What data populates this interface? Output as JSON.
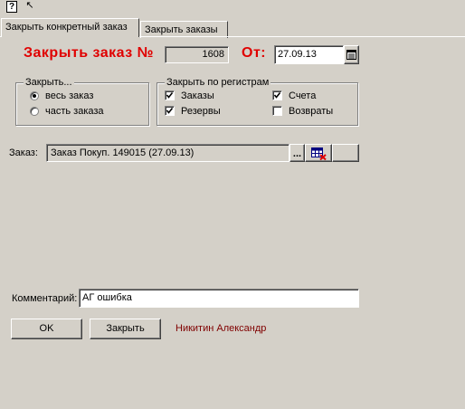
{
  "toolbar": {
    "help_icon": "?",
    "cursor_icon": "↖"
  },
  "tabs": [
    {
      "label": "Закрыть конкретный заказ"
    },
    {
      "label": "Закрыть  заказы"
    }
  ],
  "header": {
    "title": "Закрыть заказ №",
    "order_number": "1608",
    "from_label": "От:",
    "date": "27.09.13"
  },
  "close_group": {
    "title": "Закрыть...",
    "options": [
      {
        "label": "весь заказ",
        "selected": true
      },
      {
        "label": "часть заказа",
        "selected": false
      }
    ]
  },
  "registers_group": {
    "title": "Закрыть по регистрам",
    "items": [
      {
        "label": "Заказы",
        "checked": true
      },
      {
        "label": "Резервы",
        "checked": true
      },
      {
        "label": "Счета",
        "checked": true
      },
      {
        "label": "Возвраты",
        "checked": false
      }
    ]
  },
  "order": {
    "label": "Заказ:",
    "value": "Заказ Покуп. 149015 (27.09.13)",
    "browse_label": "..."
  },
  "comment": {
    "label": "Комментарий:",
    "value": "АГ ошибка"
  },
  "buttons": {
    "ok": "OK",
    "close": "Закрыть"
  },
  "user": {
    "name": "Никитин Александр"
  },
  "colors": {
    "title_red": "#e00000",
    "user_red": "#800000",
    "background": "#d4d0c8"
  }
}
